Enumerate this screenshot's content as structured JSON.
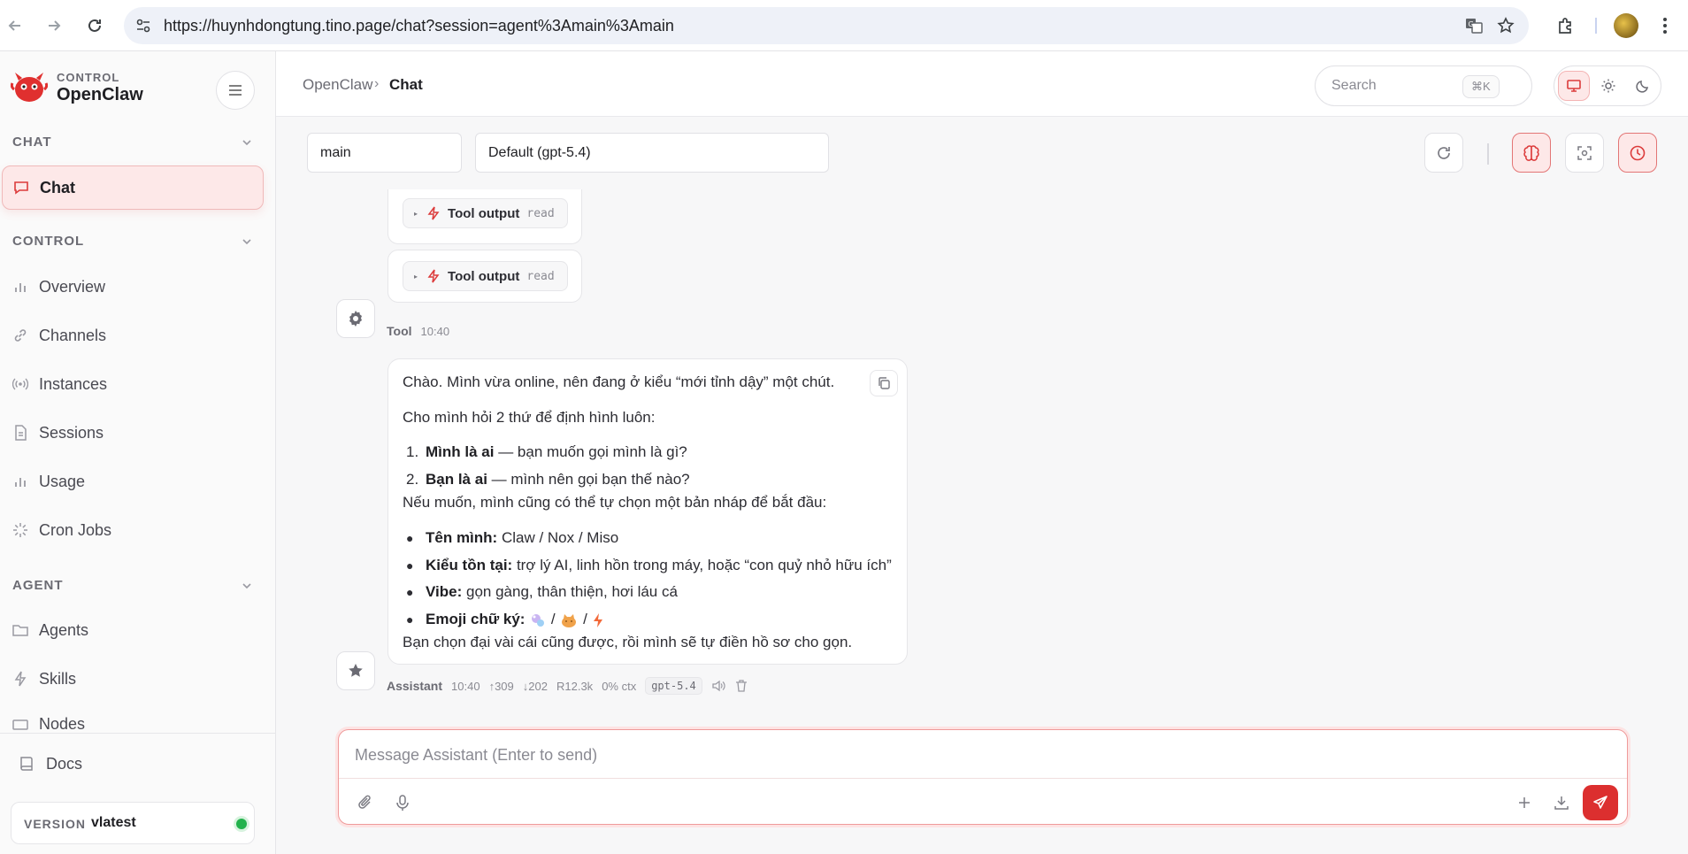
{
  "browser": {
    "url": "https://huynhdongtung.tino.page/chat?session=agent%3Amain%3Amain"
  },
  "sidebar": {
    "brand_sub": "CONTROL",
    "brand_title": "OpenClaw",
    "sections": {
      "chat": "CHAT",
      "control": "CONTROL",
      "agent": "AGENT"
    },
    "items": {
      "chat": "Chat",
      "overview": "Overview",
      "channels": "Channels",
      "instances": "Instances",
      "sessions": "Sessions",
      "usage": "Usage",
      "cron_jobs": "Cron Jobs",
      "agents": "Agents",
      "skills": "Skills",
      "nodes": "Nodes"
    },
    "docs": "Docs",
    "version_label": "VERSION",
    "version_value": "vlatest"
  },
  "header": {
    "breadcrumb_root": "OpenClaw",
    "breadcrumb_sep": "›",
    "breadcrumb_current": "Chat",
    "search_placeholder": "Search",
    "search_shortcut": "⌘K"
  },
  "controls": {
    "session": "main",
    "model": "Default (gpt-5.4)"
  },
  "messages": {
    "tool_outputs": [
      {
        "label": "Tool output",
        "name": "read"
      },
      {
        "label": "Tool output",
        "name": "read"
      }
    ],
    "tool_meta": {
      "who": "Tool",
      "time": "10:40"
    },
    "assistant": {
      "line1": "Chào. Mình vừa online, nên đang ở kiểu “mới tỉnh dậy” một chút.",
      "line2": "Cho mình hỏi 2 thứ để định hình luôn:",
      "q1_num": "1.",
      "q1_bold": "Mình là ai",
      "q1_rest": " — bạn muốn gọi mình là gì?",
      "q2_num": "2.",
      "q2_bold": "Bạn là ai",
      "q2_rest": " — mình nên gọi bạn thế nào?",
      "line3": "Nếu muốn, mình cũng có thể tự chọn một bản nháp để bắt đầu:",
      "b1_bold": "Tên mình:",
      "b1_rest": " Claw / Nox / Miso",
      "b2_bold": "Kiểu tồn tại:",
      "b2_rest": " trợ lý AI, linh hồn trong máy, hoặc “con quỷ nhỏ hữu ích”",
      "b3_bold": "Vibe:",
      "b3_rest": " gọn gàng, thân thiện, hơi láu cá",
      "b4_bold": "Emoji chữ ký:",
      "b4_sep": "/",
      "line4": "Bạn chọn đại vài cái cũng được, rồi mình sẽ tự điền hồ sơ cho gọn."
    },
    "assistant_meta": {
      "who": "Assistant",
      "time": "10:40",
      "up": "↑309",
      "down": "↓202",
      "r": "R12.3k",
      "ctx": "0% ctx",
      "model": "gpt-5.4"
    }
  },
  "composer": {
    "placeholder": "Message Assistant (Enter to send)"
  },
  "colors": {
    "accent": "#dc2f2f",
    "accent_soft": "#fde8e8",
    "status_ok": "#22b24c"
  }
}
